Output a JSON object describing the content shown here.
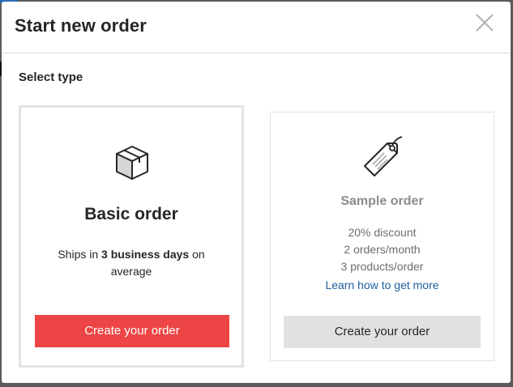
{
  "modal": {
    "title": "Start new order",
    "close_icon": "close-icon",
    "section_label": "Select type"
  },
  "basic": {
    "icon": "box-icon",
    "title": "Basic order",
    "desc_prefix": "Ships in ",
    "desc_bold": "3 business days",
    "desc_suffix": " on average",
    "button_label": "Create your order",
    "button_color": "#ed4545"
  },
  "sample": {
    "icon": "tag-icon",
    "title": "Sample order",
    "features": [
      "20% discount",
      "2 orders/month",
      "3 products/order"
    ],
    "learn_link": "Learn how to get more",
    "button_label": "Create your order",
    "link_color": "#1f5e9d"
  }
}
